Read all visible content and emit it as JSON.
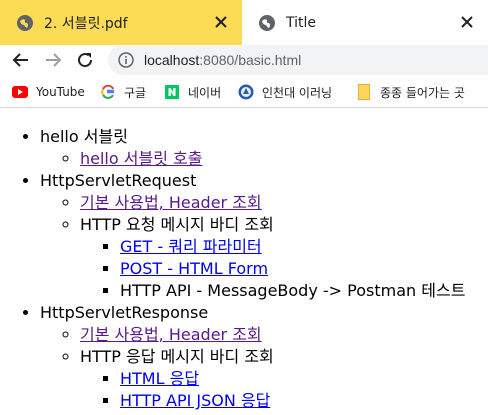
{
  "tabs": [
    {
      "title": "2. 서블릿.pdf",
      "icon": "globe-icon",
      "active": false
    },
    {
      "title": "Title",
      "icon": "globe-icon",
      "active": true
    }
  ],
  "toolbar": {
    "url_host": "localhost",
    "url_rest": ":8080/basic.html"
  },
  "bookmarks": [
    {
      "label": "YouTube",
      "icon": "youtube-icon"
    },
    {
      "label": "구글",
      "icon": "google-icon"
    },
    {
      "label": "네이버",
      "icon": "naver-icon"
    },
    {
      "label": "인천대 이러닝",
      "icon": "university-seal-icon"
    },
    {
      "label": "종종 들어가는 곳",
      "icon": "folder-icon"
    }
  ],
  "content": {
    "sections": [
      {
        "label": "hello 서블릿",
        "children": [
          {
            "link": "hello 서블릿 호출",
            "visited": true
          }
        ]
      },
      {
        "label": "HttpServletRequest",
        "children": [
          {
            "link": "기본 사용법, Header 조회",
            "visited": true
          },
          {
            "label": "HTTP 요청 메시지 바디 조회",
            "children": [
              {
                "link": "GET - 쿼리 파라미터"
              },
              {
                "link": "POST - HTML Form"
              },
              {
                "label": "HTTP API - MessageBody -> Postman 테스트"
              }
            ]
          }
        ]
      },
      {
        "label": "HttpServletResponse",
        "children": [
          {
            "link": "기본 사용법, Header 조회",
            "visited": true
          },
          {
            "label": "HTTP 응답 메시지 바디 조회",
            "children": [
              {
                "link": "HTML 응답"
              },
              {
                "link": "HTTP API JSON 응답"
              }
            ]
          }
        ]
      }
    ]
  }
}
